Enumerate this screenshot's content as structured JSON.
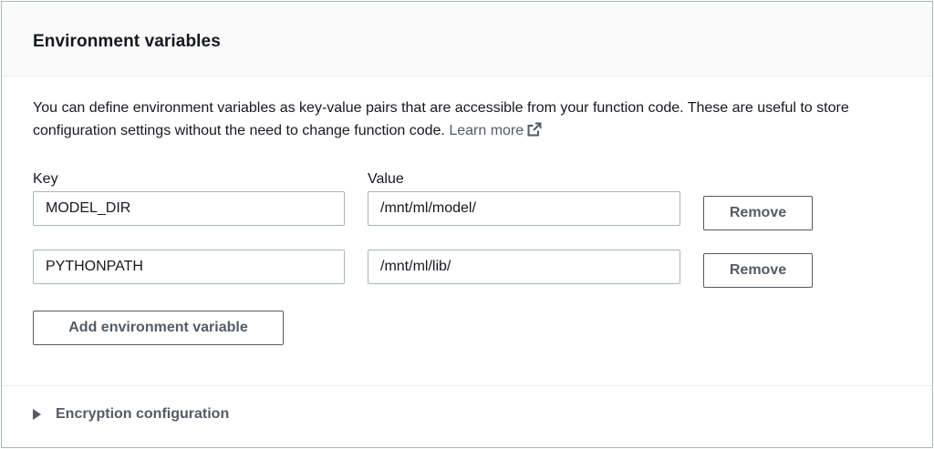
{
  "section": {
    "title": "Environment variables",
    "description": "You can define environment variables as key-value pairs that are accessible from your function code. These are useful to store configuration settings without the need to change function code.",
    "learn_more": "Learn more",
    "learn_more_icon": "external-link-icon"
  },
  "columns": {
    "key_label": "Key",
    "value_label": "Value"
  },
  "variables": [
    {
      "key": "MODEL_DIR",
      "value": "/mnt/ml/model/",
      "remove_label": "Remove"
    },
    {
      "key": "PYTHONPATH",
      "value": "/mnt/ml/lib/",
      "remove_label": "Remove"
    }
  ],
  "add_button": "Add environment variable",
  "encryption": {
    "label": "Encryption configuration",
    "icon": "caret-right-icon",
    "expanded": false
  },
  "colors": {
    "text": "#16191f",
    "secondary": "#545b64",
    "border": "#aab7b8",
    "header_bg": "#fafafa"
  }
}
